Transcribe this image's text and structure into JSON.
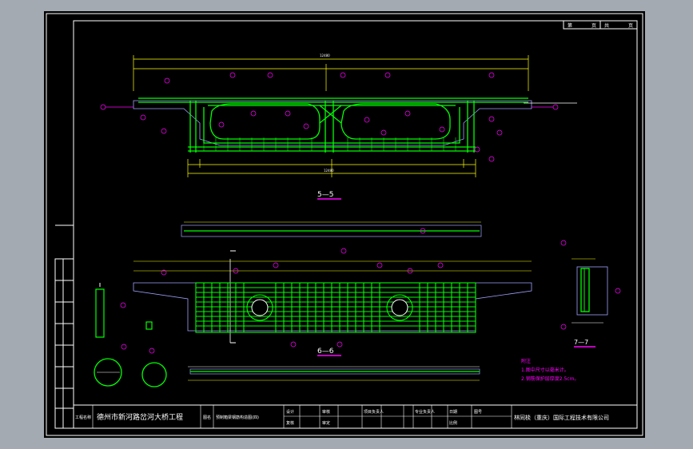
{
  "title_block": {
    "project_label": "工程名称",
    "project_name": "德州市新河路岔河大桥工程",
    "drawing_label": "图名",
    "drawing_name": "预制箱梁钢筋构造图(四)",
    "design_label": "设计",
    "check_label": "复核",
    "review_label": "审核",
    "approve_label": "审定",
    "leader_label": "项目负责人",
    "chief_label": "专业负责人",
    "date_label": "日期",
    "scale_label": "比例",
    "number_label": "图号",
    "company": "林同棪（重庆）国际工程技术有限公司"
  },
  "sheet_corner": {
    "page_label": "第",
    "total_label": "共",
    "page_unit": "页"
  },
  "section_titles": {
    "sec5": "5—5",
    "sec6": "6—6",
    "sec7": "7—7"
  },
  "notes": {
    "title": "附注",
    "line1": "1.图中尺寸以毫米计。",
    "line2": "2.钢筋保护层厚度2.5cm。"
  },
  "colors": {
    "outline": "#ffffff",
    "rebar": "#00ff00",
    "dimension": "#ffff00",
    "annotation": "#ff00ff",
    "concrete": "#a0a0ff"
  }
}
